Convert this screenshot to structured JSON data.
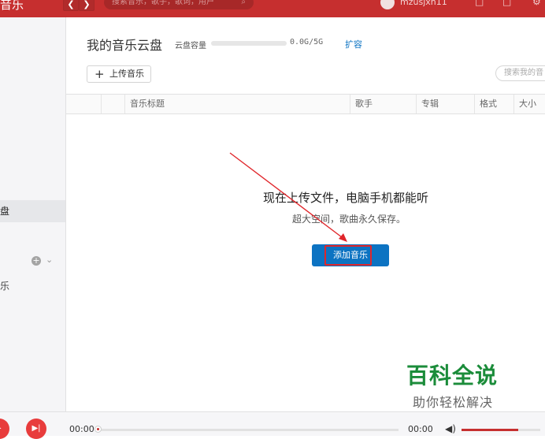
{
  "topbar": {
    "logo_text": "音乐",
    "back_glyph": "❮",
    "forward_glyph": "❯",
    "search_placeholder": "搜索音乐，歌手，歌词，用户",
    "username": "mzusjxh11",
    "icons": [
      "user-avatar",
      "shirt-icon",
      "mail-icon",
      "settings-icon"
    ]
  },
  "sidebar": {
    "active_item_fragment": "盘",
    "plus_glyph": "+",
    "chevron_glyph": "⌄",
    "item_fragment": "乐"
  },
  "header": {
    "title": "我的音乐云盘",
    "capacity_label": "云盘容量",
    "capacity_text": "0.0G/5G",
    "capacity_used_fraction": 0.0,
    "expand_label": "扩容",
    "upload_label": "上传音乐",
    "upload_plus": "+",
    "search_placeholder": "搜索我的音"
  },
  "table": {
    "columns": [
      "",
      "",
      "音乐标题",
      "歌手",
      "专辑",
      "格式",
      "大小"
    ]
  },
  "empty_state": {
    "title": "现在上传文件，电脑手机都能听",
    "subtitle": "超大空间，歌曲永久保存。",
    "add_button_label": "添加音乐"
  },
  "watermark": {
    "title": "百科全说",
    "subtitle": "助你轻松解决"
  },
  "player": {
    "time_current": "00:00",
    "time_total": "00:00",
    "prev_glyph": "▸",
    "next_glyph": "▶|",
    "volume_glyph": "◀)",
    "progress_fraction": 0.0,
    "volume_fraction": 0.72
  },
  "colors": {
    "brand_red": "#c62f2f",
    "button_blue": "#0c73c2",
    "annotation_red": "#e0262b",
    "watermark_green": "#1b8c3a"
  }
}
